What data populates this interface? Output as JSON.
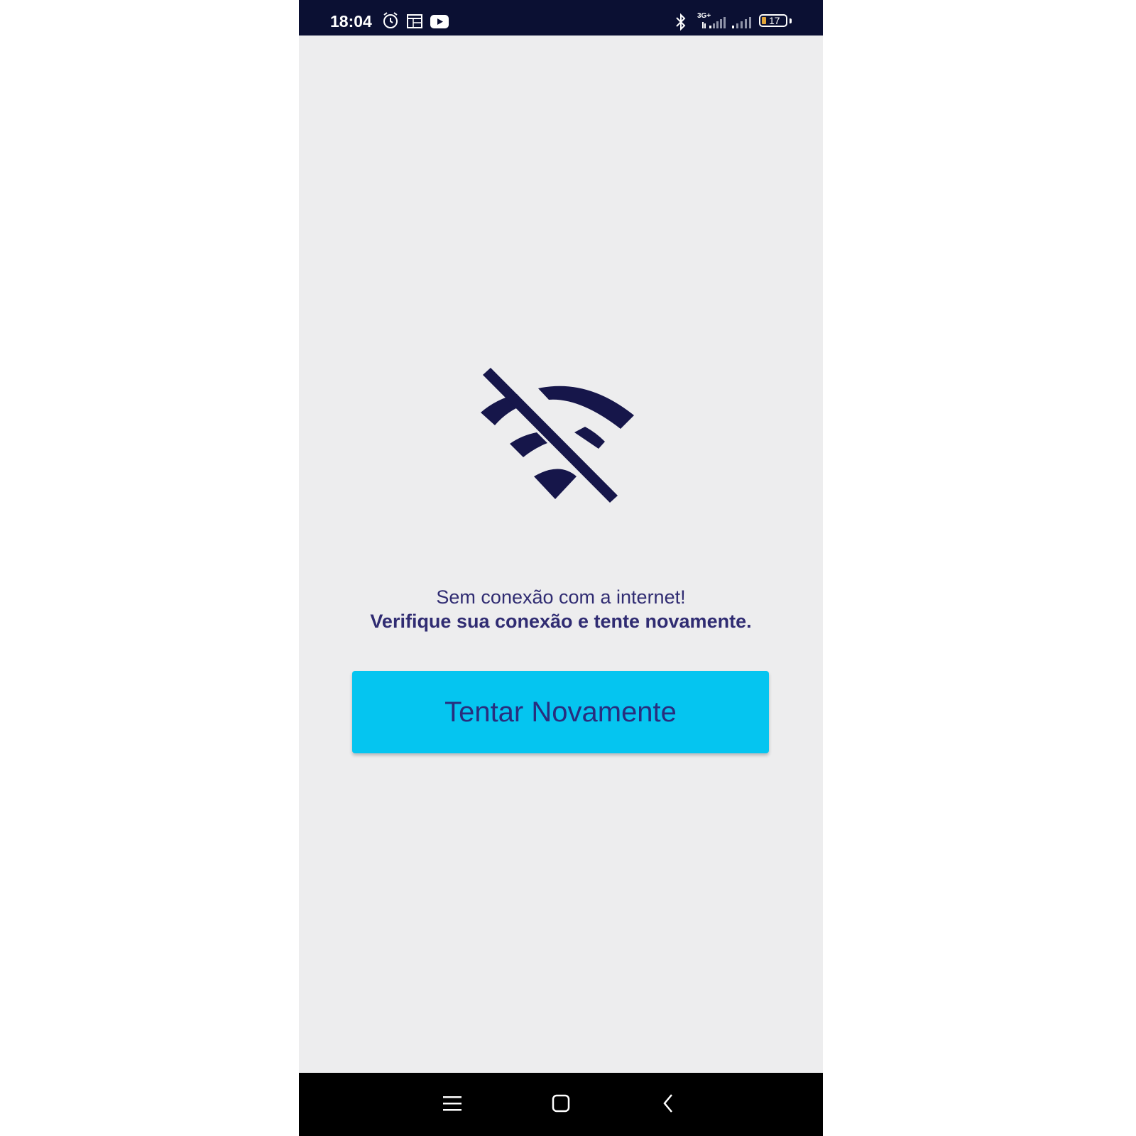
{
  "status_bar": {
    "time": "18:04",
    "network_type": "3G+",
    "battery_level": "17",
    "icons": [
      "alarm-icon",
      "calendar-icon",
      "youtube-icon",
      "bluetooth-icon",
      "signal-icon",
      "signal-icon-2",
      "battery-icon"
    ]
  },
  "main": {
    "icon": "wifi-off-icon",
    "message_line1": "Sem conexão com a internet!",
    "message_line2": "Verifique sua conexão e tente novamente.",
    "retry_label": "Tentar Novamente"
  },
  "nav_bar": {
    "icons": [
      "menu-icon",
      "home-icon",
      "back-icon"
    ]
  },
  "colors": {
    "status_bar_bg": "#0b1033",
    "screen_bg": "#ededee",
    "icon_color": "#16164a",
    "text_color": "#302c72",
    "button_bg": "#05c5f0",
    "button_text": "#282e7e",
    "nav_bar_bg": "#000000"
  }
}
